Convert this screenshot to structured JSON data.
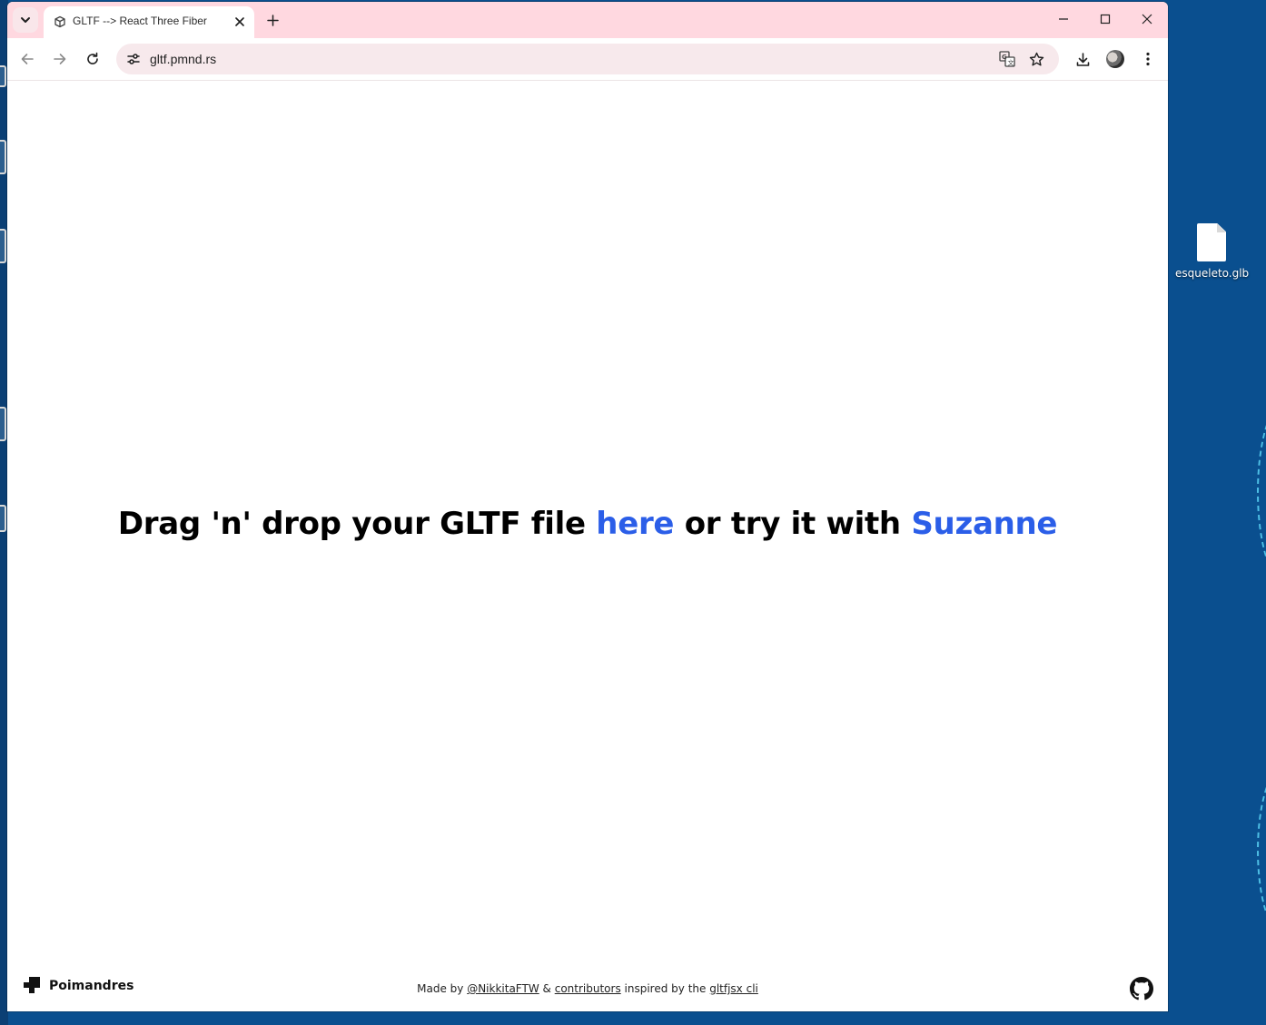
{
  "browser": {
    "tab": {
      "title": "GLTF --> React Three Fiber"
    },
    "omnibox": {
      "url": "gltf.pmnd.rs"
    }
  },
  "page": {
    "headline": {
      "prefix": "Drag 'n' drop your GLTF file",
      "here_link": "here",
      "middle": "or try it with",
      "suzanne_link": "Suzanne"
    },
    "footer": {
      "brand": "Poimandres",
      "made_by": "Made by",
      "author_link": "@NikkitaFTW",
      "amp": "&",
      "contributors_link": "contributors",
      "inspired": "inspired by the",
      "cli_link": "gltfjsx cli"
    }
  },
  "desktop": {
    "file_icon_label": "esqueleto.glb"
  },
  "colors": {
    "tabstrip": "#ffd8e0",
    "omnibox": "#f7e9ec",
    "link_blue": "#2b5ee8",
    "desktop": "#0a4f8f"
  }
}
